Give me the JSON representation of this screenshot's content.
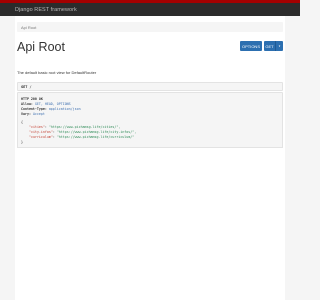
{
  "navbar": {
    "brand": "Django REST framework"
  },
  "breadcrumb": {
    "item": "Api Root"
  },
  "header": {
    "title": "Api Root",
    "options_label": "OPTIONS",
    "get_label": "GET",
    "caret": "▾"
  },
  "description": "The default basic root view for DefaultRouter",
  "request": {
    "method": "GET",
    "path": "/"
  },
  "response": {
    "status": "HTTP 200 OK",
    "headers": [
      {
        "name": "Allow:",
        "value": "GET, HEAD, OPTIONS"
      },
      {
        "name": "Content-Type:",
        "value": "application/json"
      },
      {
        "name": "Vary:",
        "value": "Accept"
      }
    ],
    "body_open": "{",
    "body_close": "}",
    "entries": [
      {
        "key": "\"cities\"",
        "value": "\"https://www.pichamsg.life/cities/\","
      },
      {
        "key": "\"city-infos\"",
        "value": "\"https://www.pichamsg.life/city-infos/\","
      },
      {
        "key": "\"curriculum\"",
        "value": "\"https://www.pichamsg.life/curriculum/\""
      }
    ]
  },
  "colors": {
    "accent": "#2c6fb0",
    "topbar": "#a30000",
    "navbar": "#2b2b2b"
  }
}
